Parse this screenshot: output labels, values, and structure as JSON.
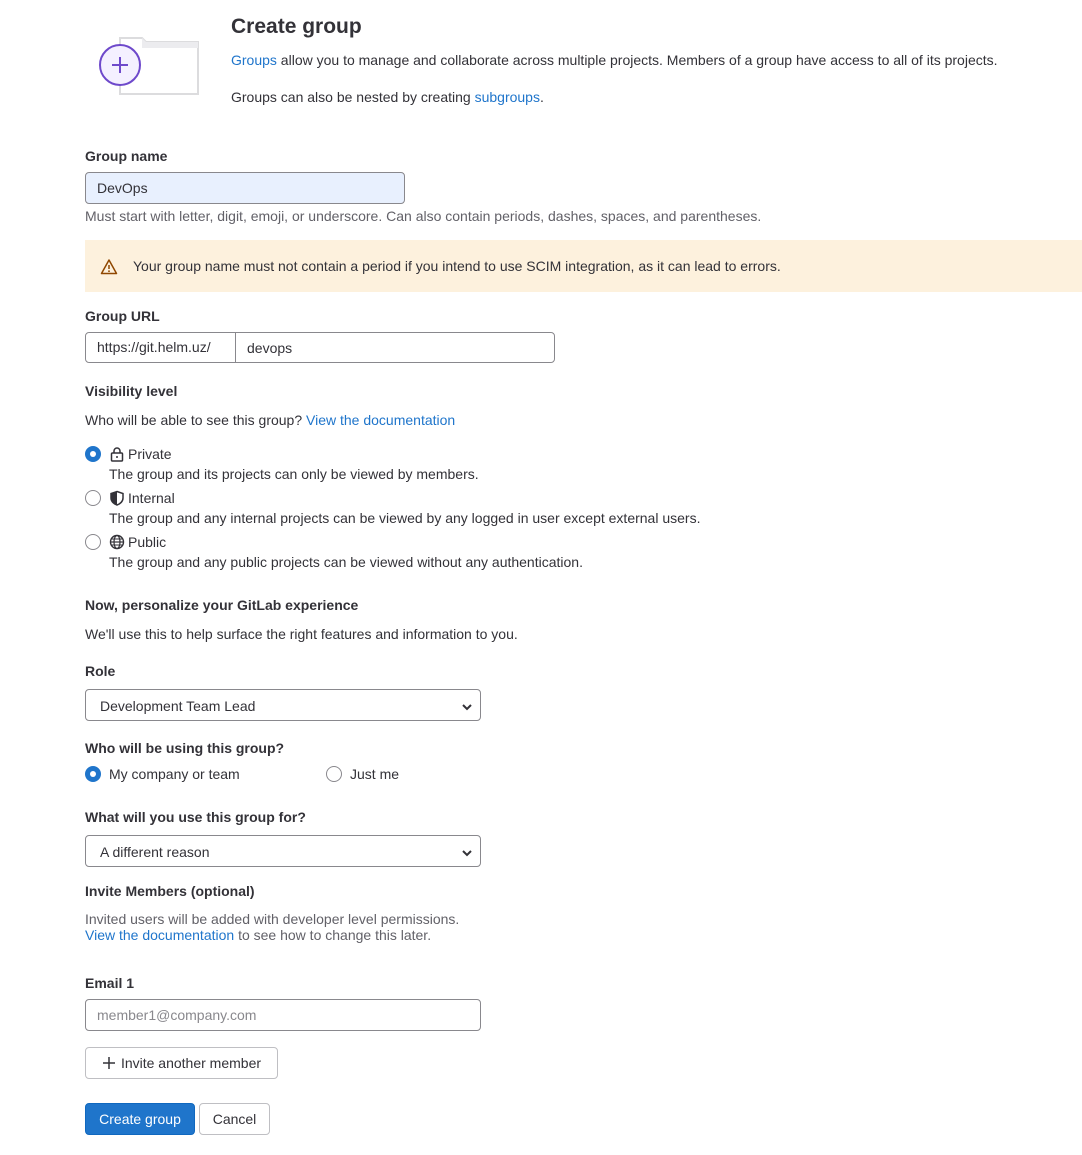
{
  "header": {
    "title": "Create group",
    "intro_link": "Groups",
    "intro_rest": " allow you to manage and collaborate across multiple projects. Members of a group have access to all of its projects.",
    "nested_prefix": "Groups can also be nested by creating ",
    "nested_link": "subgroups",
    "nested_suffix": ".",
    "illustration": "folder-plus-icon"
  },
  "group_name": {
    "label": "Group name",
    "value": "DevOps",
    "help": "Must start with letter, digit, emoji, or underscore. Can also contain periods, dashes, spaces, and parentheses."
  },
  "warning": {
    "icon": "warning-icon",
    "text": "Your group name must not contain a period if you intend to use SCIM integration, as it can lead to errors.",
    "bg_color": "#fdf1dd"
  },
  "group_url": {
    "label": "Group URL",
    "prefix": "https://git.helm.uz/",
    "path": "devops"
  },
  "visibility": {
    "label": "Visibility level",
    "help_prefix": "Who will be able to see this group? ",
    "help_link": "View the documentation",
    "options": [
      {
        "label": "Private",
        "icon": "lock-icon",
        "description": "The group and its projects can only be viewed by members.",
        "checked": true
      },
      {
        "label": "Internal",
        "icon": "shield-icon",
        "description": "The group and any internal projects can be viewed by any logged in user except external users.",
        "checked": false
      },
      {
        "label": "Public",
        "icon": "globe-icon",
        "description": "The group and any public projects can be viewed without any authentication.",
        "checked": false
      }
    ]
  },
  "personalize": {
    "title": "Now, personalize your GitLab experience",
    "help": "We'll use this to help surface the right features and information to you."
  },
  "role": {
    "label": "Role",
    "selected": "Development Team Lead"
  },
  "using": {
    "label": "Who will be using this group?",
    "options": [
      {
        "label": "My company or team",
        "checked": true
      },
      {
        "label": "Just me",
        "checked": false
      }
    ]
  },
  "use_for": {
    "label": "What will you use this group for?",
    "selected": "A different reason"
  },
  "invite": {
    "title": "Invite Members (optional)",
    "help_prefix": "Invited users will be added with developer level permissions. ",
    "help_link": "View the documentation",
    "help_suffix": " to see how to change this later.",
    "email_label": "Email 1",
    "email_placeholder": "member1@company.com",
    "invite_another": "Invite another member"
  },
  "actions": {
    "create": "Create group",
    "cancel": "Cancel",
    "primary_color": "#1f75cb"
  }
}
